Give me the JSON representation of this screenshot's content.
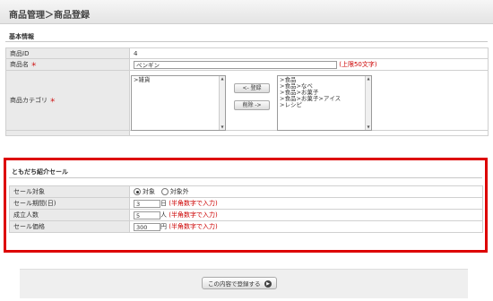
{
  "header": {
    "title": "商品管理＞商品登録"
  },
  "basic": {
    "heading": "基本情報",
    "id_label": "商品ID",
    "id_value": "4",
    "name_label": "商品名",
    "required_mark": "＊",
    "name_value": "ペンギン",
    "name_note": "(上限50文字)",
    "category_label": "商品カテゴリ",
    "left_list": [
      ">雑貨"
    ],
    "add_button": "<- 登録",
    "remove_button": "削除 ->",
    "right_list": [
      ">食品",
      ">食品>なべ",
      ">食品>お菓子",
      ">食品>お菓子>アイス",
      ">レシピ"
    ]
  },
  "sale": {
    "heading": "ともだち紹介セール",
    "target_label": "セール対象",
    "target_on": "対象",
    "target_off": "対象外",
    "target_selected": "対象",
    "period_label": "セール期間(日)",
    "period_value": "3",
    "period_unit": "日",
    "period_note": "(半角数字で入力)",
    "people_label": "成立人数",
    "people_value": "5",
    "people_unit": "人",
    "people_note": "(半角数字で入力)",
    "price_label": "セール価格",
    "price_value": "300",
    "price_unit": "円",
    "price_note": "(半角数字で入力)"
  },
  "footer": {
    "submit_label": "この内容で登録する",
    "submit_icon": "arrow-right-icon"
  },
  "colors": {
    "highlight_border": "#dd0000",
    "required": "#cc0000"
  }
}
